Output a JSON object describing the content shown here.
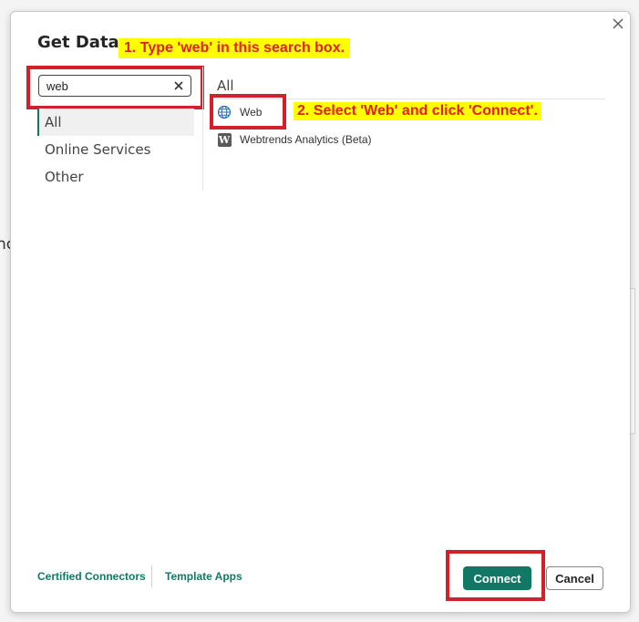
{
  "background": {
    "fragment_text": "nc"
  },
  "dialog": {
    "title": "Get Data",
    "close_icon": "close-icon"
  },
  "annotations": {
    "step1": "1. Type 'web' in this search box.",
    "step2": "2. Select 'Web' and click 'Connect'."
  },
  "search": {
    "value": "web",
    "placeholder": "",
    "clear_icon": "clear-icon"
  },
  "categories": [
    {
      "label": "All",
      "selected": true
    },
    {
      "label": "Online Services",
      "selected": false
    },
    {
      "label": "Other",
      "selected": false
    }
  ],
  "results": {
    "heading": "All",
    "items": [
      {
        "label": "Web",
        "icon": "globe-icon"
      },
      {
        "label": "Webtrends Analytics (Beta)",
        "icon": "webtrends-icon",
        "icon_glyph": "W"
      }
    ]
  },
  "footer": {
    "certified_connectors": "Certified Connectors",
    "template_apps": "Template Apps",
    "connect_label": "Connect",
    "cancel_label": "Cancel"
  },
  "colors": {
    "accent": "#117865",
    "highlight_box": "#d3202a",
    "callout_bg": "#ffff00",
    "callout_text": "#e0201a"
  }
}
